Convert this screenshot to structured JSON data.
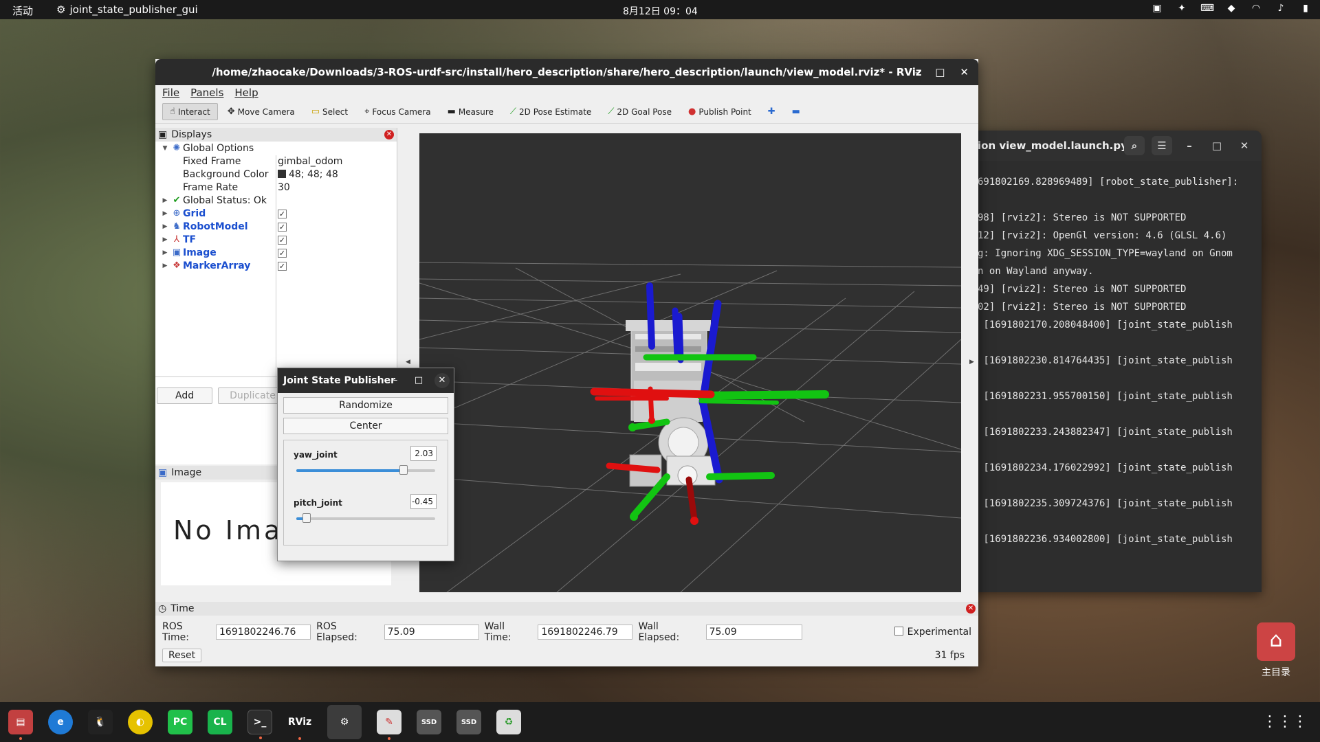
{
  "topbar": {
    "activities": "活动",
    "app": "joint_state_publisher_gui",
    "clock": "8月12日 09：04"
  },
  "terminal": {
    "title": "ion view_model.launch.py",
    "lines": [
      "691802169.828969489] [robot_state_publisher]:",
      "",
      "98] [rviz2]: Stereo is NOT SUPPORTED",
      "12] [rviz2]: OpenGl version: 4.6 (GLSL 4.6)",
      "g: Ignoring XDG_SESSION_TYPE=wayland on Gnom",
      "n on Wayland anyway.",
      "49] [rviz2]: Stereo is NOT SUPPORTED",
      "02] [rviz2]: Stereo is NOT SUPPORTED",
      " [1691802170.208048400] [joint_state_publish",
      "",
      " [1691802230.814764435] [joint_state_publish",
      "",
      " [1691802231.955700150] [joint_state_publish",
      "",
      " [1691802233.243882347] [joint_state_publish",
      "",
      " [1691802234.176022992] [joint_state_publish",
      "",
      " [1691802235.309724376] [joint_state_publish",
      "",
      " [1691802236.934002800] [joint_state_publish"
    ]
  },
  "rviz": {
    "title": "/home/zhaocake/Downloads/3-ROS-urdf-src/install/hero_description/share/hero_description/launch/view_model.rviz* - RViz",
    "menu": [
      "File",
      "Panels",
      "Help"
    ],
    "tools": [
      "Interact",
      "Move Camera",
      "Select",
      "Focus Camera",
      "Measure",
      "2D Pose Estimate",
      "2D Goal Pose",
      "Publish Point"
    ],
    "displays": {
      "title": "Displays",
      "global_options": "Global Options",
      "fixed_frame_label": "Fixed Frame",
      "fixed_frame_value": "gimbal_odom",
      "bg_label": "Background Color",
      "bg_value": "48; 48; 48",
      "frame_rate_label": "Frame Rate",
      "frame_rate_value": "30",
      "global_status": "Global Status: Ok",
      "items": [
        "Grid",
        "RobotModel",
        "TF",
        "Image",
        "MarkerArray"
      ],
      "add": "Add",
      "duplicate": "Duplicate"
    },
    "image_panel": {
      "title": "Image",
      "no_image": "No Image"
    },
    "time": {
      "title": "Time",
      "ros_time_label": "ROS Time:",
      "ros_time": "1691802246.76",
      "ros_elapsed_label": "ROS Elapsed:",
      "ros_elapsed": "75.09",
      "wall_time_label": "Wall Time:",
      "wall_time": "1691802246.79",
      "wall_elapsed_label": "Wall Elapsed:",
      "wall_elapsed": "75.09",
      "experimental": "Experimental",
      "reset": "Reset",
      "fps": "31 fps"
    }
  },
  "jsp": {
    "title": "Joint State Publisher",
    "randomize": "Randomize",
    "center": "Center",
    "yaw_label": "yaw_joint",
    "yaw_value": "2.03",
    "yaw_fraction": 0.82,
    "pitch_label": "pitch_joint",
    "pitch_value": "-0.45",
    "pitch_fraction": 0.08
  },
  "desktop": {
    "home_label": "主目录"
  },
  "dock": [
    "files",
    "edge",
    "qq",
    "pycharm-icon",
    "clion-icon",
    "terminal",
    "rviz",
    "settings",
    "text-editor",
    "ssd",
    "ssd",
    "trash"
  ],
  "colors": {
    "viewport_bg": "#303030",
    "axis_red": "#e01010",
    "axis_green": "#12c412",
    "axis_blue": "#1a1ad0"
  }
}
